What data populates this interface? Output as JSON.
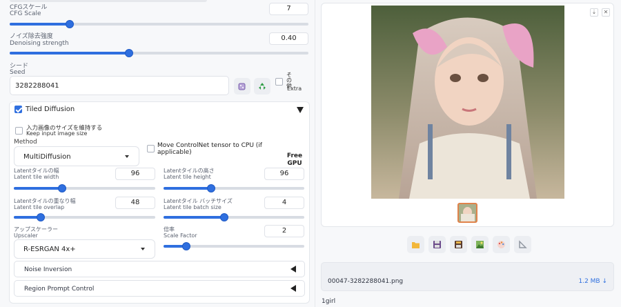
{
  "cfg": {
    "label_jp": "CFGスケール",
    "label_en": "CFG Scale",
    "value": "7",
    "level": 0.2
  },
  "denoise": {
    "label_jp": "ノイズ除去強度",
    "label_en": "Denoising strength",
    "value": "0.40",
    "level": 0.4
  },
  "seed": {
    "label_jp": "シード",
    "label_en": "Seed",
    "value": "3282288041",
    "extra_jp": "その他",
    "extra_en": "Extra",
    "dice_icon": "dice-icon",
    "recycle_icon": "recycle-icon"
  },
  "tiled": {
    "title": "Tiled Diffusion",
    "keep_size_jp": "入力画像のサイズを維持する",
    "keep_size_en": "Keep input image size",
    "method_label": "Method",
    "method_value": "MultiDiffusion",
    "move_controlnet": "Move ControlNet tensor to CPU (if applicable)",
    "free_gpu": "Free GPU",
    "tile_width": {
      "label_jp": "Latentタイルの幅",
      "label_en": "Latent tile width",
      "value": "96",
      "level": 0.34
    },
    "tile_height": {
      "label_jp": "Latentタイルの高さ",
      "label_en": "Latent tile height",
      "value": "96",
      "level": 0.34
    },
    "tile_overlap": {
      "label_jp": "Latentタイルの重なり幅",
      "label_en": "Latent tile overlap",
      "value": "48",
      "level": 0.19
    },
    "batch_size": {
      "label_jp": "Latentタイル バッチサイズ",
      "label_en": "Latent tile batch size",
      "value": "4",
      "level": 0.43
    },
    "upscaler_jp": "アップスケーラー",
    "upscaler_en": "Upscaler",
    "upscaler_value": "R-ESRGAN 4x+",
    "scale": {
      "label_jp": "倍率",
      "label_en": "Scale Factor",
      "value": "2",
      "level": 0.16
    },
    "noise_inversion": "Noise Inversion",
    "region_prompt": "Region Prompt Control"
  },
  "output": {
    "filename": "00047-3282288041.png",
    "filesize": "1.2 MB ↓",
    "caption": "1girl",
    "download_icon": "download-icon",
    "close_icon": "close-icon",
    "toolbar": [
      "folder-icon",
      "save-icon",
      "zip-icon",
      "image-icon",
      "palette-icon",
      "ruler-icon"
    ]
  },
  "colors": {
    "accent": "#2f6fdf"
  }
}
